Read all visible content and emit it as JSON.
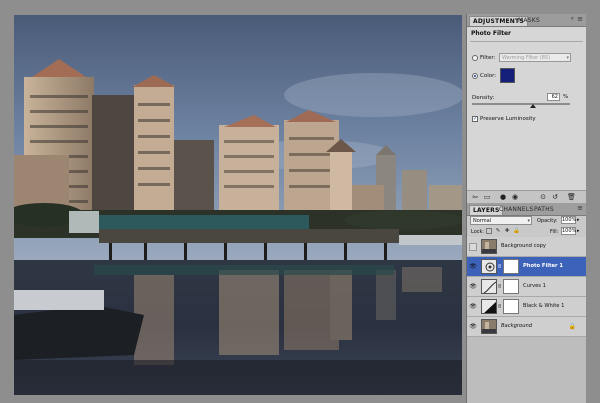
{
  "adjustments_panel": {
    "tabs": [
      "ADJUSTMENTS",
      "MASKS"
    ],
    "title": "Photo Filter",
    "filter_label": "Filter:",
    "filter_value": "Warming Filter (85)",
    "color_label": "Color:",
    "color_value": "#14207a",
    "density_label": "Density:",
    "density_value": "62",
    "density_unit": "%",
    "density_fraction": 0.62,
    "preserve_luminosity_label": "Preserve Luminosity",
    "preserve_luminosity_checked": true
  },
  "layers_panel": {
    "tabs": [
      "LAYERS",
      "CHANNELS",
      "PATHS"
    ],
    "blend_mode": "Normal",
    "opacity_label": "Opacity:",
    "opacity_value": "100%",
    "lock_label": "Lock:",
    "fill_label": "Fill:",
    "fill_value": "100%",
    "layers": [
      {
        "name": "Background copy",
        "visible": false,
        "selected": false
      },
      {
        "name": "Photo Filter 1",
        "visible": true,
        "selected": true
      },
      {
        "name": "Curves 1",
        "visible": true,
        "selected": false
      },
      {
        "name": "Black & White 1",
        "visible": true,
        "selected": false
      },
      {
        "name": "Background",
        "visible": true,
        "selected": false,
        "locked": true
      }
    ]
  },
  "icons": {
    "panel_menu": "panel-menu-icon",
    "lock": "lock-icon",
    "eye": "eye-icon",
    "link": "chain-icon"
  }
}
